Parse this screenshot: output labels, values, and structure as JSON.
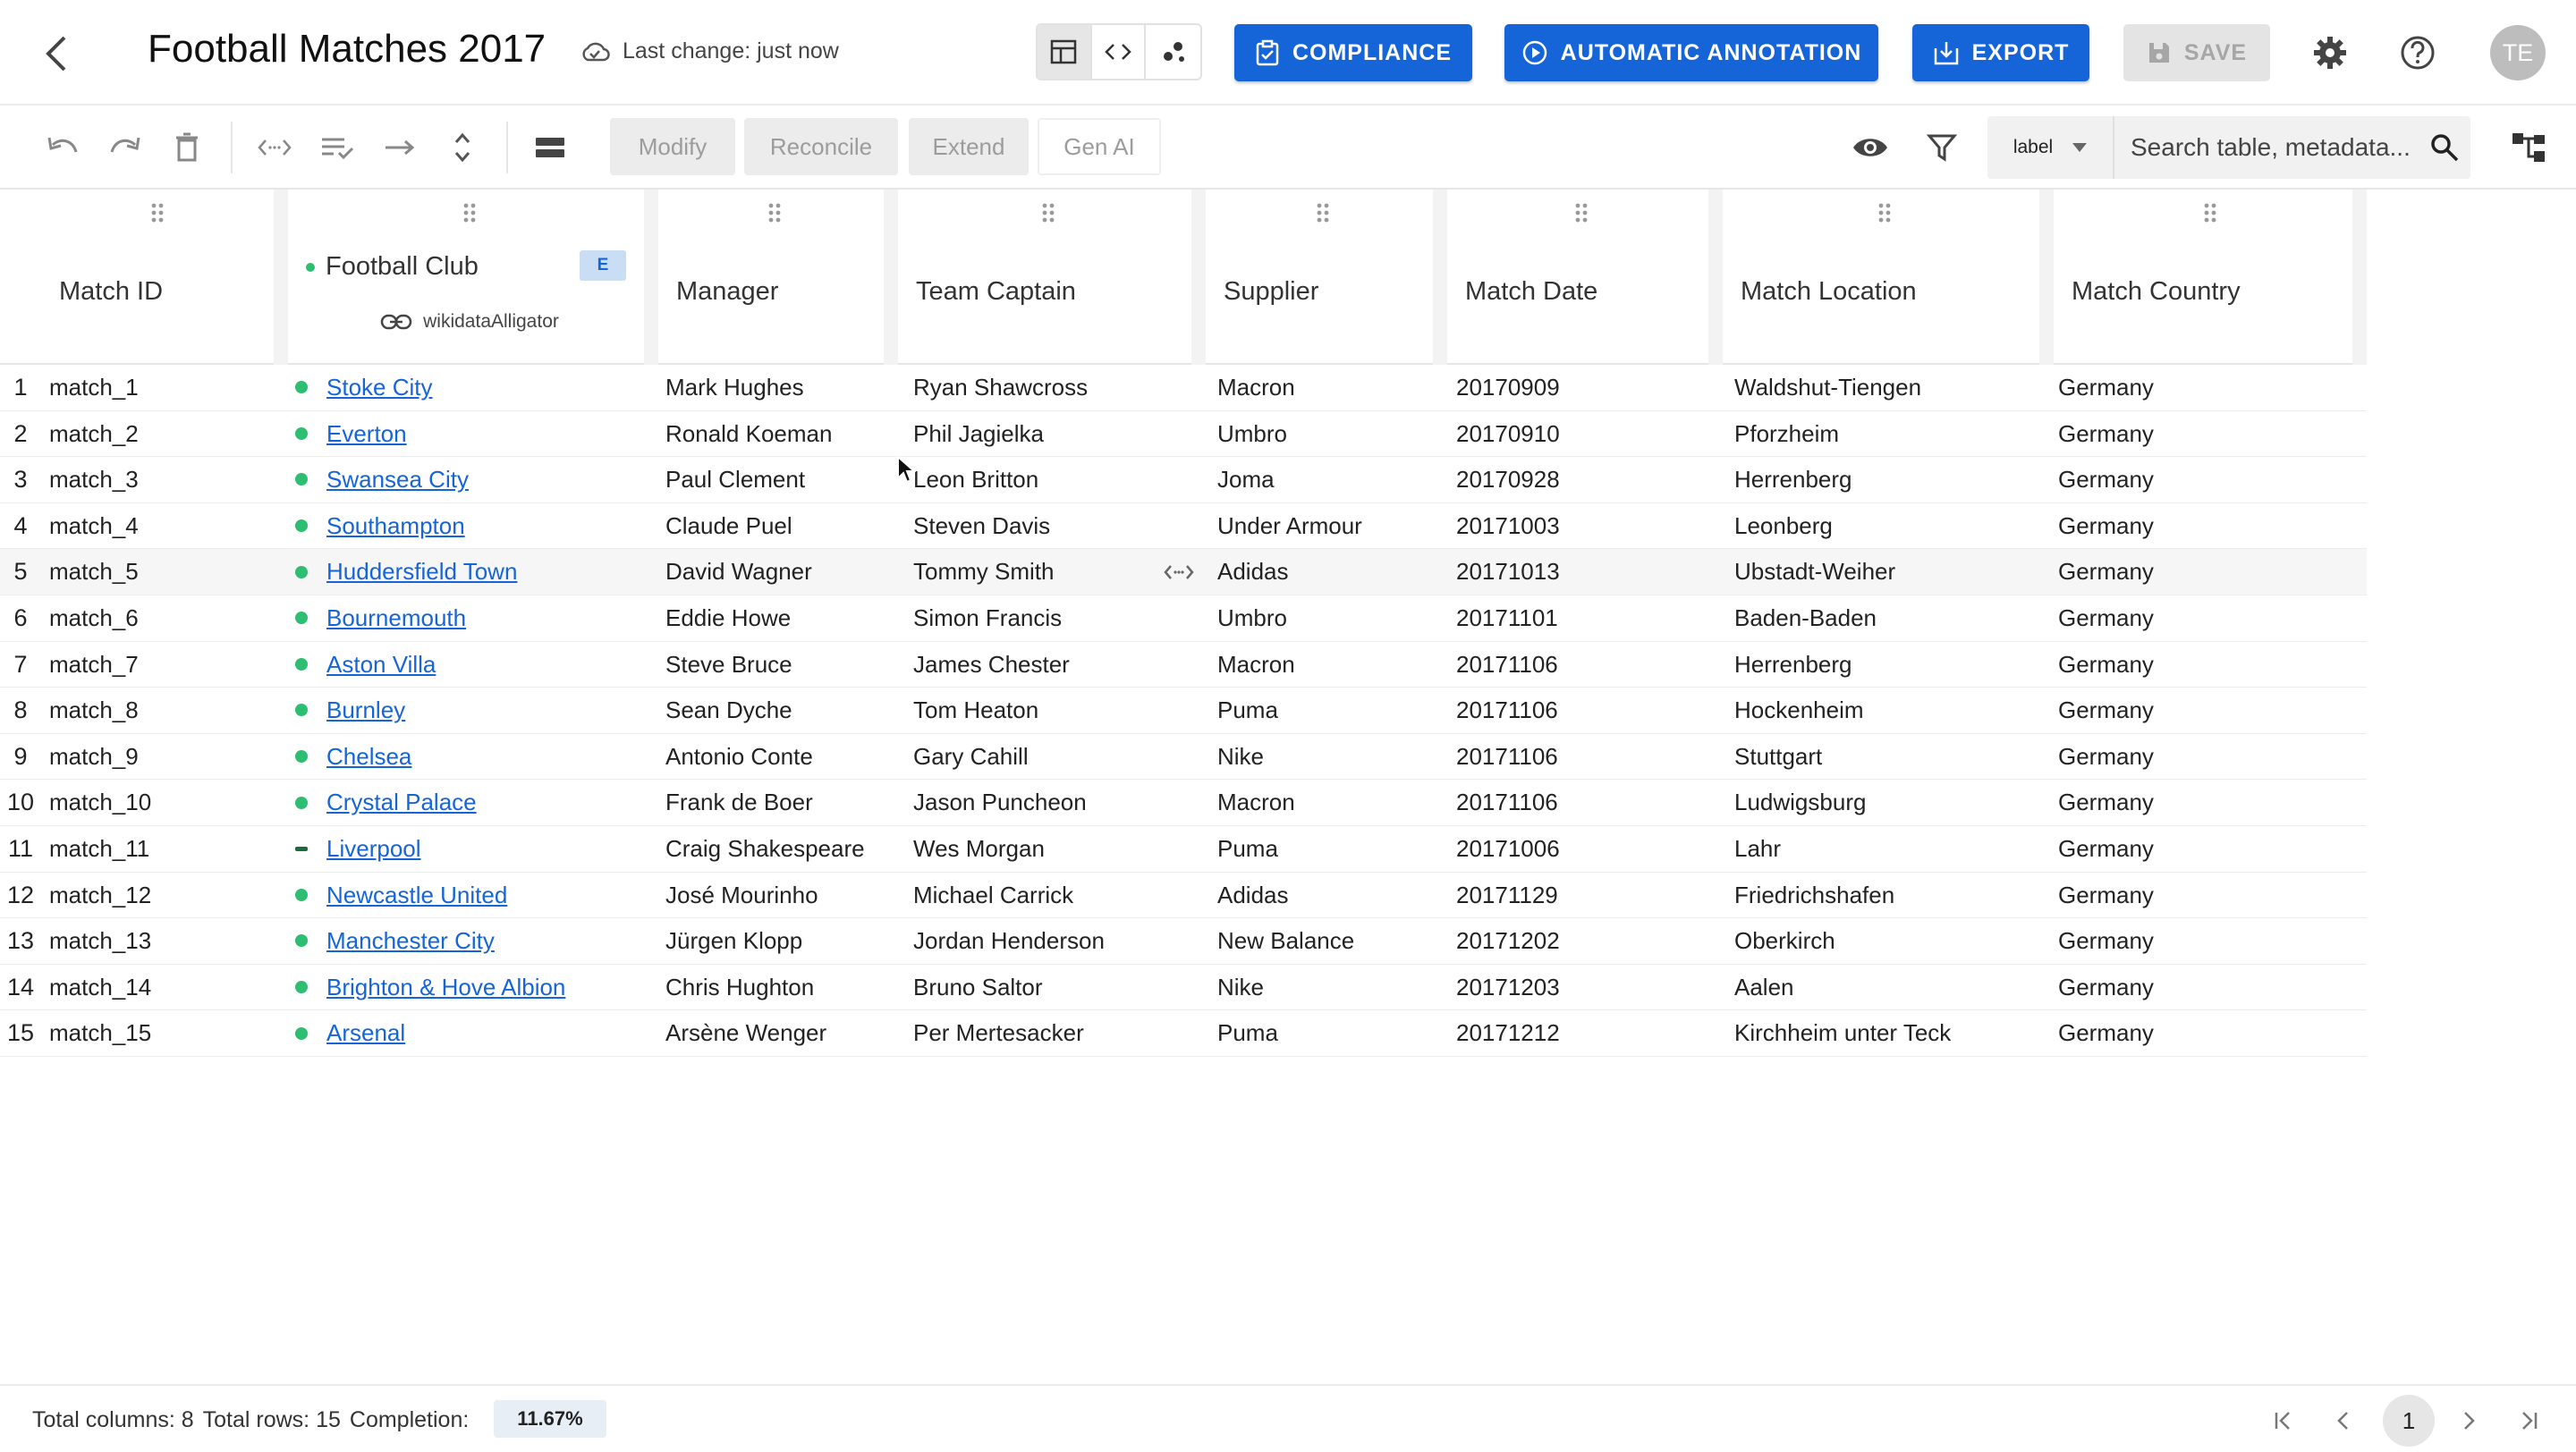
{
  "header": {
    "title": "Football Matches 2017",
    "last_change": "Last change: just now",
    "buttons": {
      "compliance": "COMPLIANCE",
      "annotation": "AUTOMATIC ANNOTATION",
      "export": "EXPORT",
      "save": "SAVE"
    },
    "avatar_initials": "TE",
    "accent_color": "#1565d8"
  },
  "toolbar": {
    "modify": "Modify",
    "reconcile": "Reconcile",
    "extend": "Extend",
    "gen_ai": "Gen AI",
    "label_select": "label",
    "search_placeholder": "Search table, metadata..."
  },
  "table": {
    "columns": [
      {
        "name": "Match ID"
      },
      {
        "name": "Football Club",
        "badge": "E",
        "reconciler": "wikidataAlligator"
      },
      {
        "name": "Manager"
      },
      {
        "name": "Team Captain"
      },
      {
        "name": "Supplier"
      },
      {
        "name": "Match Date"
      },
      {
        "name": "Match Location"
      },
      {
        "name": "Match Country"
      }
    ],
    "rows": [
      {
        "n": "1",
        "id": "match_1",
        "club": "Stoke City",
        "manager": "Mark Hughes",
        "captain": "Ryan Shawcross",
        "supplier": "Macron",
        "date": "20170909",
        "location": "Waldshut-Tiengen",
        "country": "Germany"
      },
      {
        "n": "2",
        "id": "match_2",
        "club": "Everton",
        "manager": "Ronald Koeman",
        "captain": "Phil Jagielka",
        "supplier": "Umbro",
        "date": "20170910",
        "location": "Pforzheim",
        "country": "Germany"
      },
      {
        "n": "3",
        "id": "match_3",
        "club": "Swansea City",
        "manager": "Paul Clement",
        "captain": "Leon Britton",
        "supplier": "Joma",
        "date": "20170928",
        "location": "Herrenberg",
        "country": "Germany"
      },
      {
        "n": "4",
        "id": "match_4",
        "club": "Southampton",
        "manager": "Claude Puel",
        "captain": "Steven Davis",
        "supplier": "Under Armour",
        "date": "20171003",
        "location": "Leonberg",
        "country": "Germany"
      },
      {
        "n": "5",
        "id": "match_5",
        "club": "Huddersfield Town",
        "manager": "David Wagner",
        "captain": "Tommy Smith",
        "supplier": "Adidas",
        "date": "20171013",
        "location": "Ubstadt-Weiher",
        "country": "Germany"
      },
      {
        "n": "6",
        "id": "match_6",
        "club": "Bournemouth",
        "manager": "Eddie Howe",
        "captain": "Simon Francis",
        "supplier": "Umbro",
        "date": "20171101",
        "location": "Baden-Baden",
        "country": "Germany"
      },
      {
        "n": "7",
        "id": "match_7",
        "club": "Aston Villa",
        "manager": "Steve Bruce",
        "captain": "James Chester",
        "supplier": "Macron",
        "date": "20171106",
        "location": "Herrenberg",
        "country": "Germany"
      },
      {
        "n": "8",
        "id": "match_8",
        "club": "Burnley",
        "manager": "Sean Dyche",
        "captain": "Tom Heaton",
        "supplier": "Puma",
        "date": "20171106",
        "location": "Hockenheim",
        "country": "Germany"
      },
      {
        "n": "9",
        "id": "match_9",
        "club": "Chelsea",
        "manager": "Antonio Conte",
        "captain": "Gary Cahill",
        "supplier": "Nike",
        "date": "20171106",
        "location": "Stuttgart",
        "country": "Germany"
      },
      {
        "n": "10",
        "id": "match_10",
        "club": "Crystal Palace",
        "manager": "Frank de Boer",
        "captain": "Jason Puncheon",
        "supplier": "Macron",
        "date": "20171106",
        "location": "Ludwigsburg",
        "country": "Germany"
      },
      {
        "n": "11",
        "id": "match_11",
        "club": "Liverpool",
        "manager": "Craig Shakespeare",
        "captain": "Wes Morgan",
        "supplier": "Puma",
        "date": "20171006",
        "location": "Lahr",
        "country": "Germany"
      },
      {
        "n": "12",
        "id": "match_12",
        "club": "Newcastle United",
        "manager": "José Mourinho",
        "captain": "Michael Carrick",
        "supplier": "Adidas",
        "date": "20171129",
        "location": "Friedrichshafen",
        "country": "Germany"
      },
      {
        "n": "13",
        "id": "match_13",
        "club": "Manchester City",
        "manager": "Jürgen Klopp",
        "captain": "Jordan Henderson",
        "supplier": "New Balance",
        "date": "20171202",
        "location": "Oberkirch",
        "country": "Germany"
      },
      {
        "n": "14",
        "id": "match_14",
        "club": "Brighton & Hove Albion",
        "manager": "Chris Hughton",
        "captain": "Bruno Saltor",
        "supplier": "Nike",
        "date": "20171203",
        "location": "Aalen",
        "country": "Germany"
      },
      {
        "n": "15",
        "id": "match_15",
        "club": "Arsenal",
        "manager": "Arsène Wenger",
        "captain": "Per Mertesacker",
        "supplier": "Puma",
        "date": "20171212",
        "location": "Kirchheim unter Teck",
        "country": "Germany"
      }
    ]
  },
  "footer": {
    "total_columns": "Total columns: 8",
    "total_rows": "Total rows: 15",
    "completion_label": "Completion:",
    "completion_value": "11.67%",
    "current_page": "1"
  }
}
